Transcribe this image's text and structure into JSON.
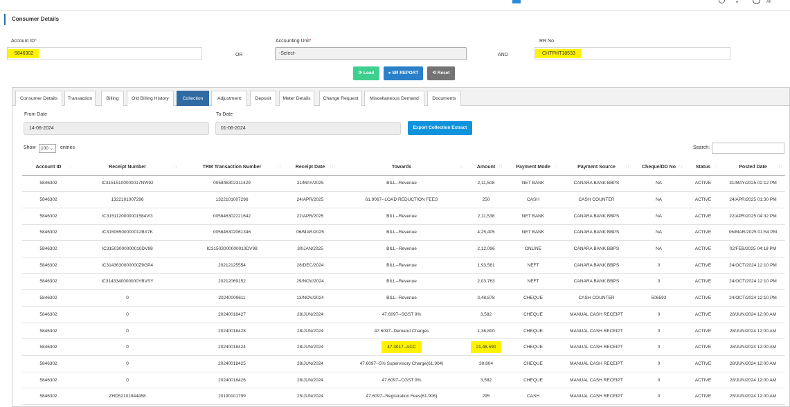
{
  "top_bar": {
    "all_label": "All"
  },
  "panel": {
    "title": "Consumer Details"
  },
  "form": {
    "account_label": "Account ID",
    "account_value": "5846302",
    "or_label": "OR",
    "accounting_unit_label": "Accounting Unit",
    "accounting_unit_value": "-Select-",
    "and_label": "AND",
    "rr_label": "RR No",
    "rr_value": "CHTPHT18533",
    "required_mark": "*"
  },
  "buttons": {
    "load": "Load",
    "sr_report": "SR REPORT",
    "reset": "Reset"
  },
  "tabs": [
    "Consumer Details",
    "Transaction",
    "Billing",
    "Old Billing History",
    "Collection",
    "Adjustment",
    "Deposit",
    "Meter Details",
    "Change Request",
    "Miscellaneous Demand",
    "Documents"
  ],
  "active_tab": "Collection",
  "filters": {
    "from_label": "From Date",
    "from_value": "14-06-2024",
    "to_label": "To Date",
    "to_value": "01-06-2024",
    "export_label": "Export Collection Extract"
  },
  "table_controls": {
    "show_label": "Show",
    "show_value": "100",
    "entries_label": "entries",
    "search_label": "Search:"
  },
  "table": {
    "columns": [
      "Account ID",
      "Receipt Number",
      "TRM Transaction Number",
      "Receipt Date",
      "Towards",
      "Amount",
      "Payment Mode",
      "Payment Source",
      "Cheque/DD No",
      "Status",
      "Posted Date"
    ],
    "rows": [
      [
        "5846302",
        "IC31515100000017NW92",
        "005846302311429",
        "31/MAY/2025",
        "BILL--Revenue",
        "2,11,508",
        "NET BANK",
        "CANARA BANK BBPS",
        "NA",
        "ACTIVE",
        "31/MAY/2025 02:12 PM"
      ],
      [
        "5846302",
        "1322101007296",
        "1322101007296",
        "24/APR/2025",
        "61.9067--LOAD REDUCTION FEES",
        "250",
        "CASH",
        "CASH COUNTER",
        "NA",
        "ACTIVE",
        "24/APR/2025 01:30 PM"
      ],
      [
        "5846302",
        "IC3151120000001584VG",
        "005846302221642",
        "22/APR/2025",
        "BILL--Revenue",
        "2,11,538",
        "NET BANK",
        "CANARA BANK BBPS",
        "NA",
        "ACTIVE",
        "22/APR/2025 04:32 PM"
      ],
      [
        "5846302",
        "IC31506500000012BX7K",
        "005846302061346",
        "06/MAR/2025",
        "BILL--Revenue",
        "4,25,405",
        "NET BANK",
        "CANARA BANK BBPS",
        "NA",
        "ACTIVE",
        "06/MAR/2025 01:54 PM"
      ],
      [
        "5846302",
        "IC31503000000010DV98",
        "IC31503000000010DV98",
        "30/JAN/2025",
        "BILL--Revenue",
        "2,12,096",
        "ONLINE",
        "CANARA BANK BBPS",
        "NA",
        "ACTIVE",
        "02/FEB/2025 04:18 PM"
      ],
      [
        "5846302",
        "IC3143630000000Z9GP4",
        "20212125554",
        "28/DEC/2024",
        "BILL--Revenue",
        "1,93,561",
        "NEFT",
        "CANARA BANK BBPS",
        "0",
        "ACTIVE",
        "24/OCT/2024 12:10 PM"
      ],
      [
        "5846302",
        "IC3143340000000YBVSY",
        "20212069152",
        "29/NOV/2024",
        "BILL--Revenue",
        "2,03,763",
        "NEFT",
        "CANARA BANK BBPS",
        "0",
        "ACTIVE",
        "24/OCT/2024 12:10 PM"
      ],
      [
        "5846302",
        "0",
        "20240009611",
        "13/NOV/2024",
        "BILL--Revenue",
        "3,48,878",
        "CHEQUE",
        "CASH COUNTER",
        "506593",
        "ACTIVE",
        "24/OCT/2024 12:10 PM"
      ],
      [
        "5846302",
        "0",
        "20240018427",
        "28/JUN/2024",
        "47.6097--SGST 9%",
        "3,582",
        "CHEQUE",
        "MANUAL CASH RECEIPT",
        "0",
        "ACTIVE",
        "28/JUN/2024 12:00 AM"
      ],
      [
        "5846302",
        "0",
        "20240018428",
        "28/JUN/2024",
        "47.6097--Demand Charges",
        "1,36,800",
        "CHEQUE",
        "MANUAL CASH RECEIPT",
        "0",
        "ACTIVE",
        "28/JUN/2024 12:00 AM"
      ],
      [
        "5846302",
        "0",
        "20240018424",
        "28/JUN/2024",
        "47.3017--ACC",
        "21,46,590",
        "CHEQUE",
        "MANUAL CASH RECEIPT",
        "0",
        "ACTIVE",
        "28/JUN/2024 12:00 AM"
      ],
      [
        "5846302",
        "0",
        "20240018425",
        "28/JUN/2024",
        "47.6097--5% Supervisory Charge(61.904)",
        "39,804",
        "CHEQUE",
        "MANUAL CASH RECEIPT",
        "0",
        "ACTIVE",
        "28/JUN/2024 12:00 AM"
      ],
      [
        "5846302",
        "0",
        "20240018426",
        "28/JUN/2024",
        "47.6097--CGST 9%",
        "3,582",
        "CHEQUE",
        "MANUAL CASH RECEIPT",
        "0",
        "ACTIVE",
        "28/JUN/2024 12:00 AM"
      ],
      [
        "5846302",
        "ZHD52101844458",
        "20190101799",
        "25/JUN/2024",
        "47.6097--Registration Fees(61.906)",
        "295",
        "CASH",
        "MANUAL CASH RECEIPT",
        "0",
        "ACTIVE",
        "25/JUN/2024 12:00 AM"
      ]
    ],
    "highlight_row": 10
  },
  "colors": {
    "highlight": "#fff200",
    "load": "#3ecf8e",
    "sr": "#2980c8",
    "reset": "#737373",
    "export": "#0f93dc",
    "active_tab": "#2f6aa3"
  }
}
